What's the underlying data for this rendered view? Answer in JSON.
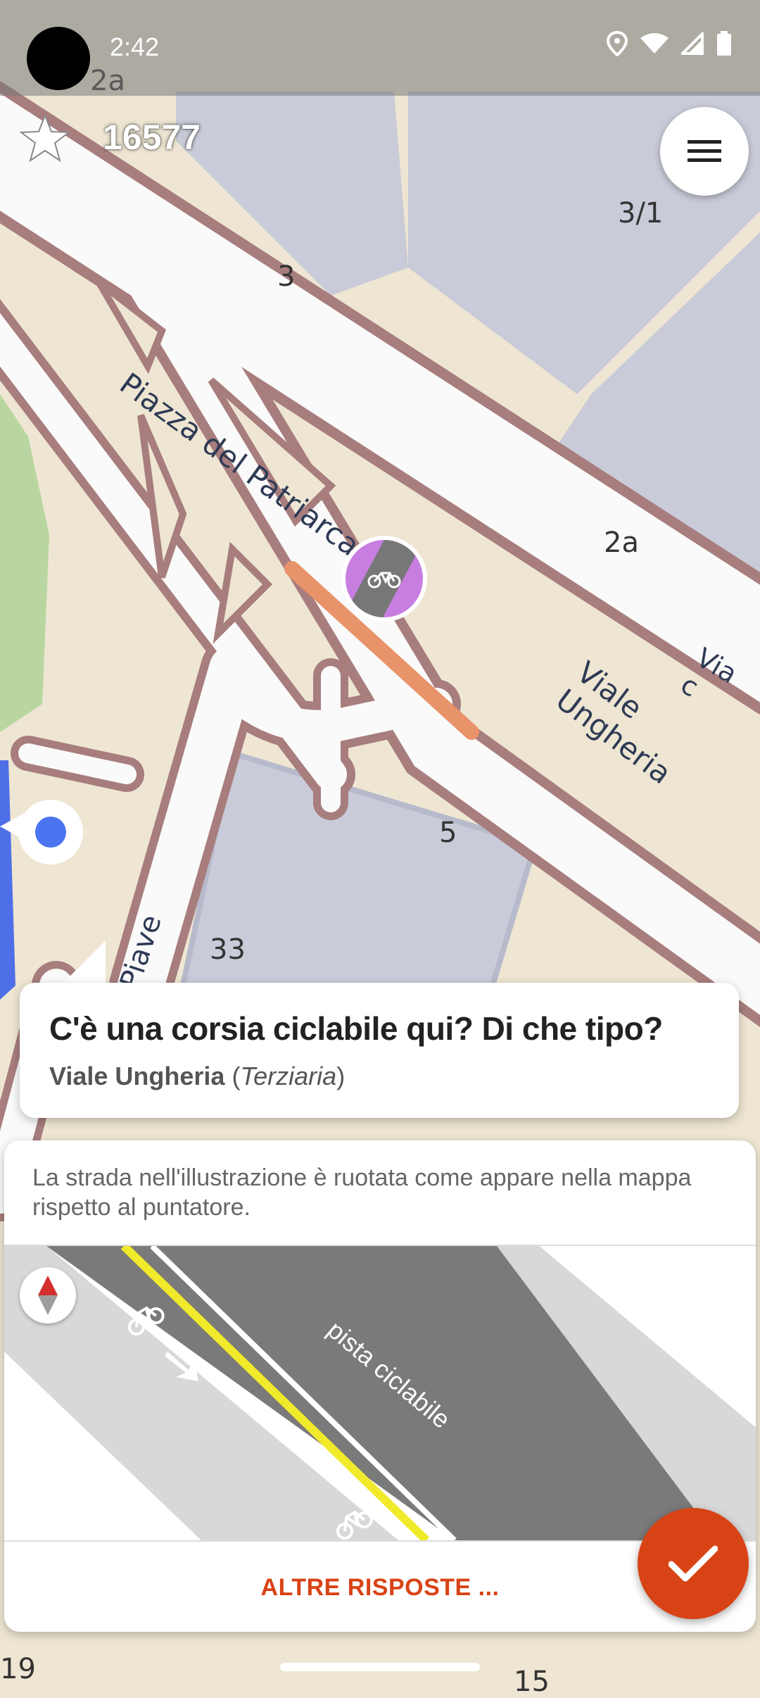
{
  "status_bar": {
    "time": "2:42",
    "icons": [
      "location-icon",
      "wifi-icon",
      "signal-icon",
      "battery-icon"
    ]
  },
  "top_bar": {
    "points": "16577",
    "star_icon": "star-icon",
    "menu_icon": "hamburger-menu-icon"
  },
  "map": {
    "street_labels": [
      "Piazza del Patriarcato",
      "Viale Ungheria",
      "Via c",
      "Piave"
    ],
    "house_numbers": [
      "2a",
      "3/1",
      "3",
      "2a",
      "5",
      "33",
      "19",
      "15"
    ],
    "quest_pin_icon": "bicycle-lane-icon"
  },
  "quest": {
    "title": "C'è una corsia ciclabile qui? Di che tipo?",
    "street_name": "Viale Ungheria",
    "road_class": "Terziaria"
  },
  "answer": {
    "hint": "La strada nell'illustrazione è ruotata come appare nella mappa rispetto al puntatore.",
    "illustration_label": "pista ciclabile",
    "compass_icon": "compass-icon",
    "other_answers_label": "ALTRE RISPOSTE ...",
    "ok_icon": "checkmark-icon"
  },
  "colors": {
    "accent": "#d84315",
    "map_land": "#eee6d2",
    "road_casing": "#a87d7d",
    "building": "#c9cbd9"
  }
}
